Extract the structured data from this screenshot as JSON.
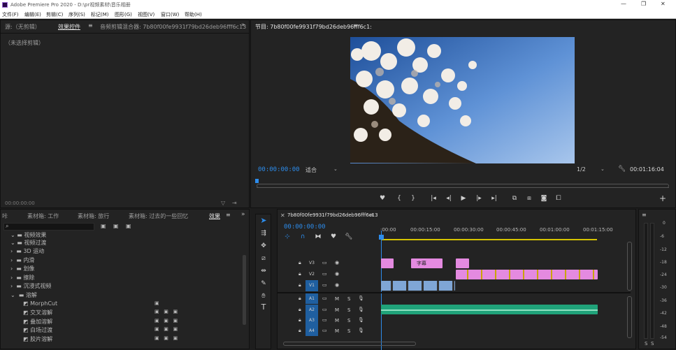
{
  "window": {
    "title": "Adobe Premiere Pro 2020 - D:\\pr视频素材\\音乐相册",
    "controls": [
      "—",
      "❐",
      "✕"
    ]
  },
  "menu": [
    "文件(F)",
    "编辑(E)",
    "剪辑(C)",
    "序列(S)",
    "标记(M)",
    "图形(G)",
    "视图(V)",
    "窗口(W)",
    "帮助(H)"
  ],
  "source_panel": {
    "tabs": [
      "源:（无剪辑）",
      "效果控件",
      "音频剪辑混合器: 7b80f00fe9931f79bd26deb96fff6c13"
    ],
    "active_tab": "效果控件",
    "no_clip": "（未选择剪辑）",
    "timecode": "00:00:00:00"
  },
  "program_panel": {
    "title": "节目: 7b80f00fe9931f79bd26deb96fff6c1:",
    "timecode": "00:00:00:00",
    "fit": "适合",
    "resolution": "1/2",
    "duration": "00:01:16:04"
  },
  "project_panel": {
    "tabs": [
      "咔",
      "素材箱: 工作",
      "素材箱: 旅行",
      "素材箱: 过去的一些回忆",
      "效果"
    ],
    "active_tab": "效果",
    "tree": [
      {
        "label": "视频效果",
        "level": 0,
        "expanded": true
      },
      {
        "label": "视频过渡",
        "level": 0,
        "expanded": true
      },
      {
        "label": "3D 运动",
        "level": 1,
        "expanded": false
      },
      {
        "label": "内滑",
        "level": 1,
        "expanded": false
      },
      {
        "label": "划像",
        "level": 1,
        "expanded": false
      },
      {
        "label": "擦除",
        "level": 1,
        "expanded": false
      },
      {
        "label": "沉浸式视频",
        "level": 1,
        "expanded": false
      },
      {
        "label": "溶解",
        "level": 1,
        "expanded": true
      },
      {
        "label": "MorphCut",
        "level": 2
      },
      {
        "label": "交叉溶解",
        "level": 2
      },
      {
        "label": "叠加溶解",
        "level": 2
      },
      {
        "label": "白场过渡",
        "level": 2
      },
      {
        "label": "胶片溶解",
        "level": 2
      }
    ]
  },
  "timeline": {
    "title": "7b80f00fe9931f79bd26deb96fff6c13",
    "timecode": "00:00:00:00",
    "ruler": [
      ":00:00",
      "00:00:15:00",
      "00:00:30:00",
      "00:00:45:00",
      "00:01:00:00",
      "00:01:15:00"
    ],
    "video_tracks": [
      "V3",
      "V2",
      "V1"
    ],
    "audio_tracks": [
      "A1",
      "A2",
      "A3",
      "A4"
    ],
    "subtitle_clip": "字幕",
    "track_buttons": [
      "M",
      "S"
    ]
  },
  "meter": {
    "labels": [
      "0",
      "-6",
      "-12",
      "-18",
      "-24",
      "-30",
      "-36",
      "-42",
      "-48",
      "-54"
    ],
    "solo": [
      "S",
      "S"
    ]
  },
  "colors": {
    "accent": "#2d8ceb",
    "pink_clip": "#e48ae0",
    "blue_clip": "#7fa6d6",
    "green_clip": "#20a37a",
    "yellow_bar": "#d6c400"
  }
}
